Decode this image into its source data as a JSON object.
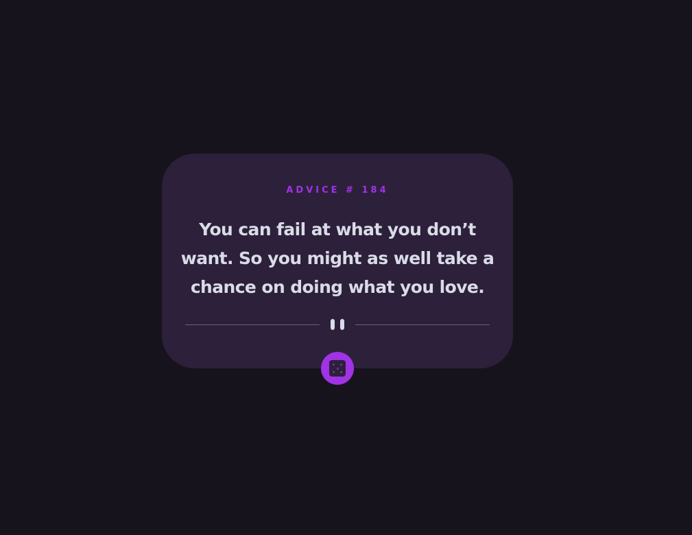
{
  "advice": {
    "label": "ADVICE # 184",
    "quote": "You can fail at what you don’t want. So you might as well take a chance on doing what you love."
  },
  "icons": {
    "divider": "pause-icon",
    "button": "dice-icon"
  },
  "colors": {
    "background": "#17131d",
    "card": "#2d203b",
    "accent": "#a033e6",
    "text": "#d9dce7",
    "divider": "#5f6675"
  }
}
